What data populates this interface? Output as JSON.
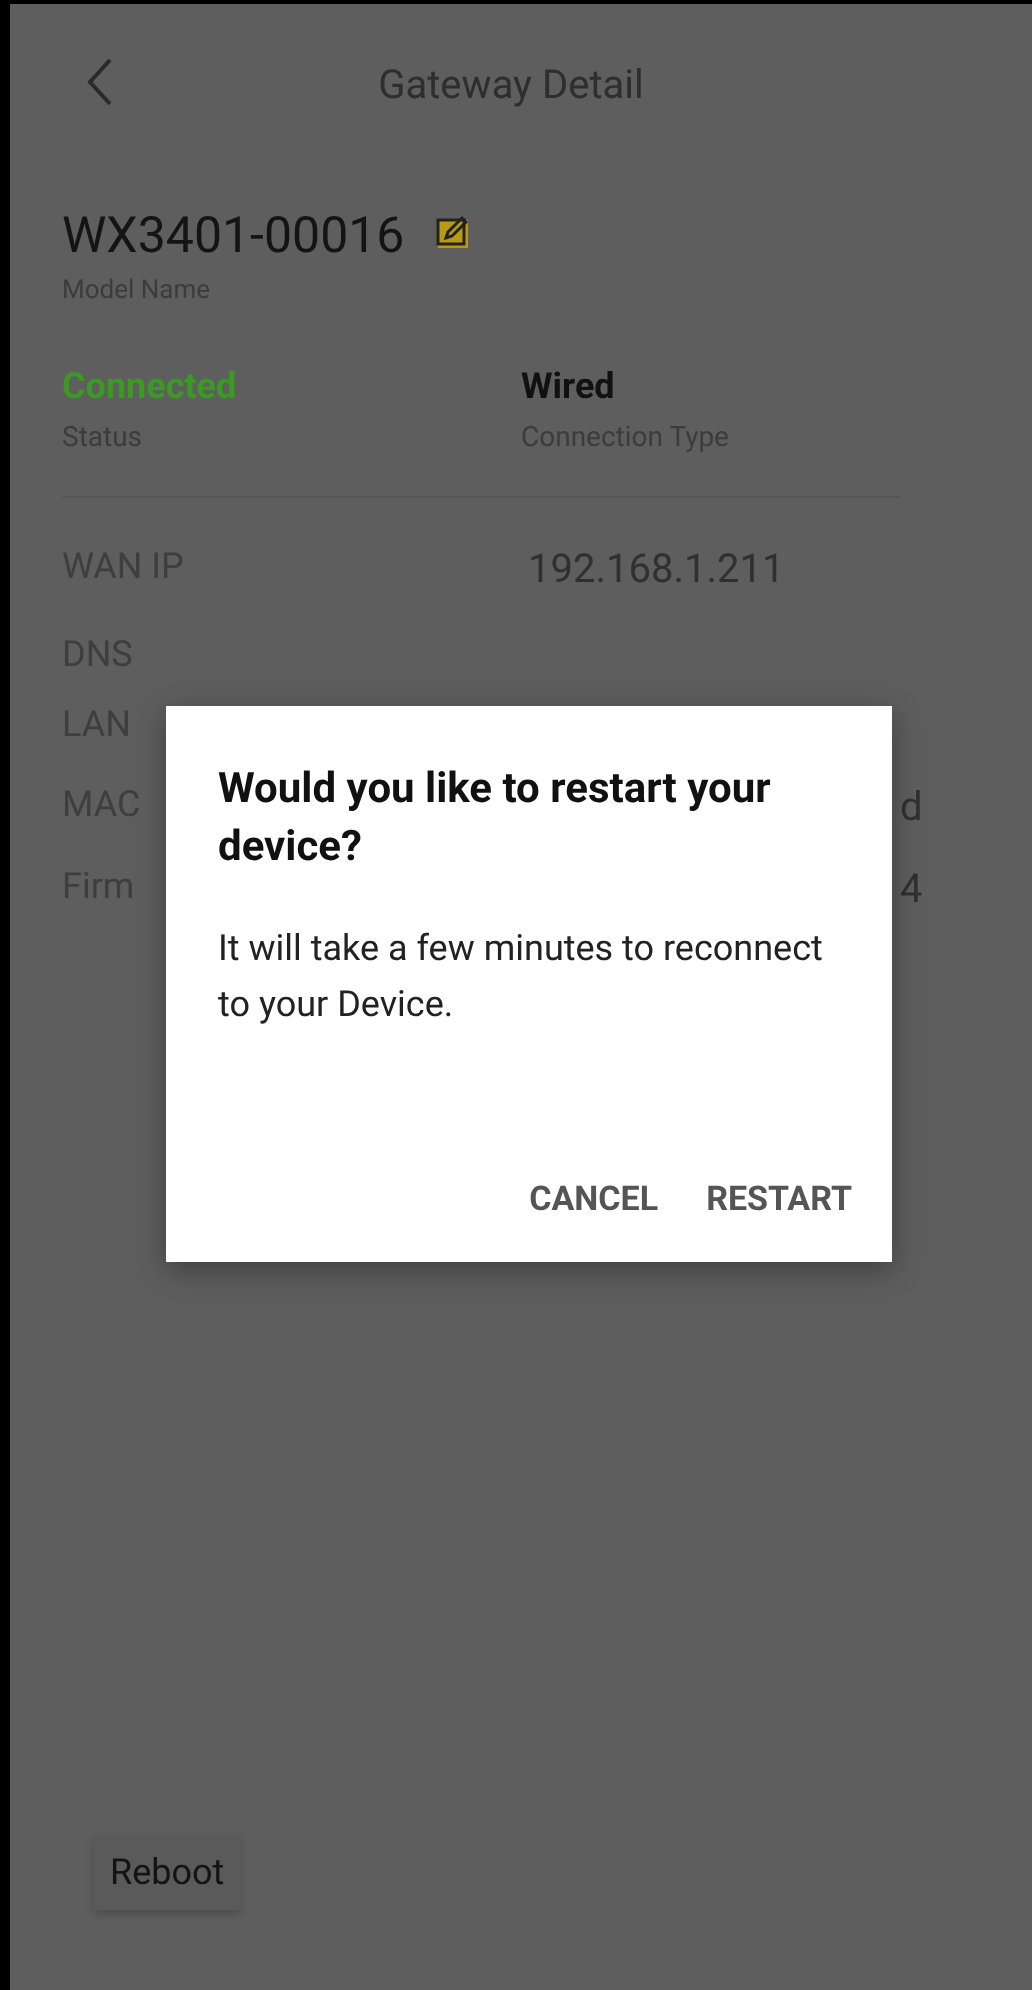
{
  "header": {
    "title": "Gateway Detail"
  },
  "device": {
    "name": "WX3401-00016",
    "name_label": "Model Name"
  },
  "summary": [
    {
      "value": "Connected",
      "label": "Status",
      "kind": "status"
    },
    {
      "value": "Wired",
      "label": "Connection Type",
      "kind": "plain"
    }
  ],
  "details": [
    {
      "label": "WAN IP",
      "value": "192.168.1.211"
    },
    {
      "label": "DNS"
    },
    {
      "label": "LAN"
    },
    {
      "label": "MAC",
      "value": "d"
    },
    {
      "label": "Firm",
      "value": "4"
    }
  ],
  "reboot_button": "Reboot",
  "dialog": {
    "title": "Would you like to restart your device?",
    "message": "It will take a few minutes to reconnect to your Device.",
    "buttons": [
      "CANCEL",
      "RESTART"
    ]
  }
}
